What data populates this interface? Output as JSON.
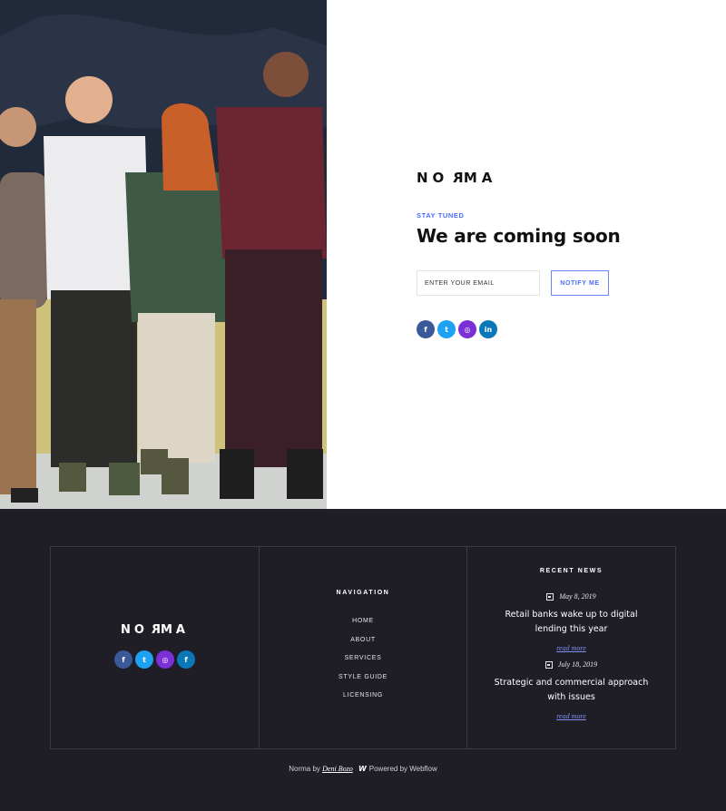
{
  "brand": {
    "logo_pre": "NO",
    "logo_r": "R",
    "logo_post": "MA"
  },
  "hero": {
    "eyebrow": "STAY TUNED",
    "headline": "We are coming soon",
    "email_placeholder": "ENTER YOUR EMAIL",
    "notify_label": "NOTIFY ME",
    "social": [
      {
        "icon": "facebook-icon",
        "glyph": "f",
        "color": "#3b5998"
      },
      {
        "icon": "twitter-icon",
        "glyph": "t",
        "color": "#1da1f2"
      },
      {
        "icon": "instagram-icon",
        "glyph": "◎",
        "color": "#7b2fd6"
      },
      {
        "icon": "linkedin-icon",
        "glyph": "in",
        "color": "#0a78b8"
      }
    ]
  },
  "footer": {
    "social": [
      {
        "icon": "facebook-icon",
        "glyph": "f",
        "color": "#3b5998"
      },
      {
        "icon": "twitter-icon",
        "glyph": "t",
        "color": "#1da1f2"
      },
      {
        "icon": "instagram-icon",
        "glyph": "◎",
        "color": "#7b2fd6"
      },
      {
        "icon": "facebook-icon",
        "glyph": "f",
        "color": "#0a78b8"
      }
    ],
    "navigation_heading": "NAVIGATION",
    "nav_items": [
      "HOME",
      "ABOUT",
      "SERVICES",
      "STYLE GUIDE",
      "LICENSING"
    ],
    "news_heading": "RECENT NEWS",
    "news": [
      {
        "date": "May 8, 2019",
        "title": "Retail banks wake up to digital lending this year",
        "link": "read more"
      },
      {
        "date": "July 18, 2019",
        "title": "Strategic and commercial approach with issues",
        "link": "read more"
      }
    ],
    "credits": {
      "prefix": "Norma by",
      "author": "Deni Bozo",
      "powered": "Powered by Webflow"
    }
  },
  "colors": {
    "accent": "#4a6cf7",
    "footer_bg": "#1f1e27"
  }
}
